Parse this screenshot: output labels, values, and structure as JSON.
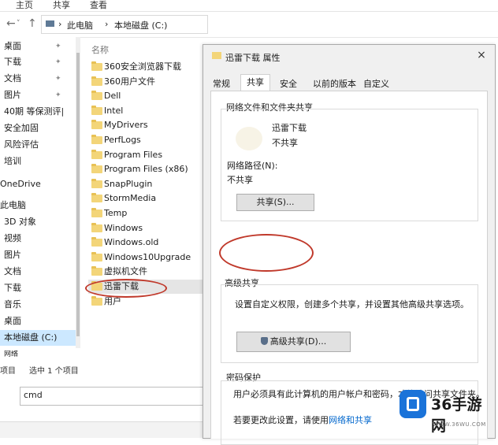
{
  "ribbon": {
    "tabs": [
      "主页",
      "共享",
      "查看"
    ]
  },
  "address": {
    "breadcrumb": [
      "此电脑",
      "本地磁盘 (C:)"
    ],
    "separator": "›"
  },
  "nav": {
    "items": [
      {
        "label": "桌面",
        "pinned": true
      },
      {
        "label": "下载",
        "pinned": true
      },
      {
        "label": "文档",
        "pinned": true
      },
      {
        "label": "图片",
        "pinned": true
      },
      {
        "label": "40期 等保测评|",
        "pinned": false
      },
      {
        "label": "安全加固",
        "pinned": false
      },
      {
        "label": "风险评估",
        "pinned": false
      },
      {
        "label": "培训",
        "pinned": false
      },
      {
        "label": "OneDrive",
        "pinned": false
      },
      {
        "label": "此电脑",
        "pinned": false
      },
      {
        "label": "3D 对象",
        "pinned": false
      },
      {
        "label": "视频",
        "pinned": false
      },
      {
        "label": "图片",
        "pinned": false
      },
      {
        "label": "文档",
        "pinned": false
      },
      {
        "label": "下载",
        "pinned": false
      },
      {
        "label": "音乐",
        "pinned": false
      },
      {
        "label": "桌面",
        "pinned": false
      },
      {
        "label": "本地磁盘 (C:)",
        "pinned": false,
        "selected": true
      },
      {
        "label": "网络",
        "pinned": false
      }
    ]
  },
  "files": {
    "column_name": "名称",
    "items": [
      "360安全浏览器下载",
      "360用户文件",
      "Dell",
      "Intel",
      "MyDrivers",
      "PerfLogs",
      "Program Files",
      "Program Files (x86)",
      "SnapPlugin",
      "StormMedia",
      "Temp",
      "Windows",
      "Windows.old",
      "Windows10Upgrade",
      "虚拟机文件",
      "迅雷下载",
      "用户"
    ],
    "highlighted": "迅雷下载"
  },
  "status": {
    "count": "项目",
    "selected": "选中 1 个项目"
  },
  "cmd": {
    "value": "cmd"
  },
  "dialog": {
    "title": "迅雷下载 属性",
    "close": "×",
    "tabs": [
      "常规",
      "共享",
      "安全",
      "以前的版本",
      "自定义"
    ],
    "active_tab": "共享",
    "network_share": {
      "title": "网络文件和文件夹共享",
      "folder_name": "迅雷下载",
      "folder_status": "不共享",
      "path_label": "网络路径(N):",
      "path_value": "不共享",
      "share_button": "共享(S)..."
    },
    "advanced_share": {
      "title": "高级共享",
      "description": "设置自定义权限，创建多个共享，并设置其他高级共享选项。",
      "button": "高级共享(D)..."
    },
    "password": {
      "title": "密码保护",
      "description": "用户必须具有此计算机的用户帐户和密码，才能访问共享文件夹。",
      "change_prefix": "若要更改此设置，请使用",
      "change_link": "网络和共享"
    }
  },
  "watermark": {
    "brand": "36手游网",
    "url": "WWW.36WU.COM"
  },
  "colors": {
    "accent_oval": "#c0392b",
    "folder": "#f3d579",
    "selection": "#cce8ff",
    "link": "#0066cc"
  }
}
